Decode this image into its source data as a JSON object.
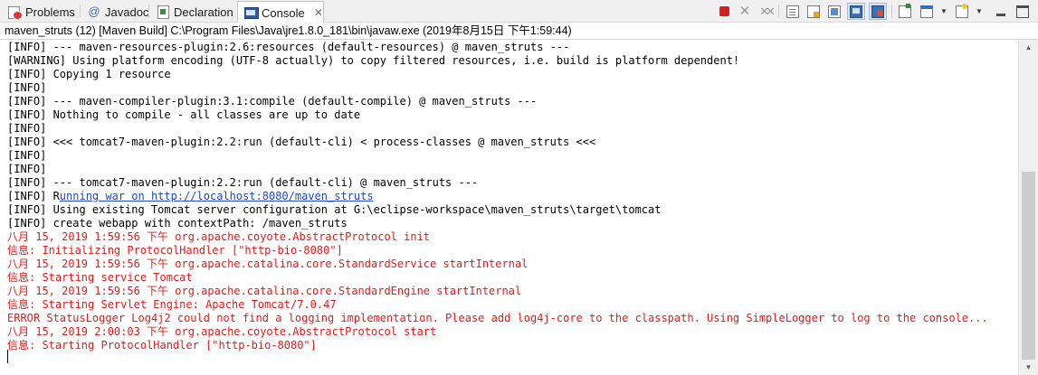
{
  "tabs": [
    {
      "label": "Problems",
      "icon": "problems-icon",
      "active": false
    },
    {
      "label": "Javadoc",
      "icon": "javadoc-at-icon",
      "active": false
    },
    {
      "label": "Declaration",
      "icon": "declaration-icon",
      "active": false
    },
    {
      "label": "Console",
      "icon": "console-icon",
      "active": true,
      "close": "✕"
    }
  ],
  "toolbar": [
    {
      "name": "terminate-button",
      "icon": "terminate-icon"
    },
    {
      "name": "remove-launch-button",
      "icon": "remove-launch-icon"
    },
    {
      "name": "remove-all-terminated-button",
      "icon": "remove-all-terminated-icon"
    },
    {
      "name": "clear-console-button",
      "icon": "clear-console-icon"
    },
    {
      "name": "scroll-lock-button",
      "icon": "scroll-lock-icon"
    },
    {
      "name": "word-wrap-button",
      "icon": "word-wrap-icon"
    },
    {
      "name": "show-on-stdout-button",
      "icon": "show-on-stdout-icon"
    },
    {
      "name": "show-on-stderr-button",
      "icon": "show-on-stderr-icon"
    },
    {
      "name": "pin-console-button",
      "icon": "pin-console-icon"
    },
    {
      "name": "display-selected-console-button",
      "icon": "display-console-icon"
    },
    {
      "name": "open-console-button",
      "icon": "new-console-icon"
    },
    {
      "name": "minimize-button",
      "icon": "minimize-icon"
    },
    {
      "name": "maximize-button",
      "icon": "maximize-icon"
    }
  ],
  "description": "maven_struts (12) [Maven Build] C:\\Program Files\\Java\\jre1.8.0_181\\bin\\javaw.exe (2019年8月15日 下午1:59:44)",
  "colors": {
    "stdout": "#000000",
    "stderr": "#e01b1b",
    "link": "#1f49c7"
  },
  "console": {
    "lines": [
      {
        "text": "[INFO] --- maven-resources-plugin:2.6:resources (default-resources) @ maven_struts ---",
        "stream": "out"
      },
      {
        "text": "[WARNING] Using platform encoding (UTF-8 actually) to copy filtered resources, i.e. build is platform dependent!",
        "stream": "out"
      },
      {
        "text": "[INFO] Copying 1 resource",
        "stream": "out"
      },
      {
        "text": "[INFO]",
        "stream": "out"
      },
      {
        "text": "[INFO] --- maven-compiler-plugin:3.1:compile (default-compile) @ maven_struts ---",
        "stream": "out"
      },
      {
        "text": "[INFO] Nothing to compile - all classes are up to date",
        "stream": "out"
      },
      {
        "text": "[INFO]",
        "stream": "out"
      },
      {
        "text": "[INFO] <<< tomcat7-maven-plugin:2.2:run (default-cli) < process-classes @ maven_struts <<<",
        "stream": "out"
      },
      {
        "text": "[INFO]",
        "stream": "out"
      },
      {
        "text": "[INFO]",
        "stream": "out"
      },
      {
        "text": "[INFO] --- tomcat7-maven-plugin:2.2:run (default-cli) @ maven_struts ---",
        "stream": "out"
      },
      {
        "prefix": "[INFO] R",
        "link": "unning war on http://localhost:8080/maven_struts",
        "stream": "out"
      },
      {
        "text": "[INFO] Using existing Tomcat server configuration at G:\\eclipse-workspace\\maven_struts\\target\\tomcat",
        "stream": "out"
      },
      {
        "text": "[INFO] create webapp with contextPath: /maven_struts",
        "stream": "out"
      },
      {
        "text": "八月 15, 2019 1:59:56 下午 org.apache.coyote.AbstractProtocol init",
        "stream": "err"
      },
      {
        "text": "信息: Initializing ProtocolHandler [\"http-bio-8080\"]",
        "stream": "err"
      },
      {
        "text": "八月 15, 2019 1:59:56 下午 org.apache.catalina.core.StandardService startInternal",
        "stream": "err"
      },
      {
        "text": "信息: Starting service Tomcat",
        "stream": "err"
      },
      {
        "text": "八月 15, 2019 1:59:56 下午 org.apache.catalina.core.StandardEngine startInternal",
        "stream": "err"
      },
      {
        "text": "信息: Starting Servlet Engine: Apache Tomcat/7.0.47",
        "stream": "err"
      },
      {
        "text": "ERROR StatusLogger Log4j2 could not find a logging implementation. Please add log4j-core to the classpath. Using SimpleLogger to log to the console...",
        "stream": "err"
      },
      {
        "text": "八月 15, 2019 2:00:03 下午 org.apache.coyote.AbstractProtocol start",
        "stream": "err"
      },
      {
        "text": "信息: Starting ProtocolHandler [\"http-bio-8080\"]",
        "stream": "err"
      }
    ]
  },
  "scrollbar": {
    "up": "▲",
    "down": "▼"
  }
}
